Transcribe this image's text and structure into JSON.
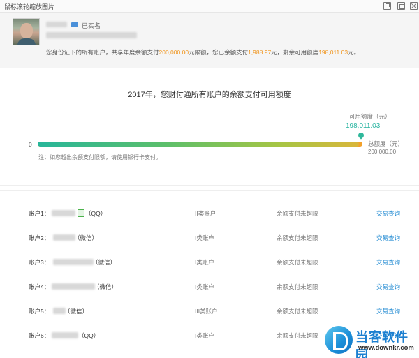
{
  "window": {
    "title": "鼠标滚轮缩放图片"
  },
  "profile": {
    "verified_label": "已实名",
    "limit_text_prefix": "您身份证下的所有账户，共享年度余额支付",
    "annual_limit": "200,000.00",
    "limit_text_mid1": "元限额，您已余额支付",
    "used_amount": "1,988.97",
    "limit_text_mid2": "元，剩余可用额度",
    "remaining_amount": "198,011.03",
    "limit_text_suffix": "元。"
  },
  "quota": {
    "title": "2017年，您财付通所有账户的余额支付可用额度",
    "available_label": "可用额度（元）",
    "available_value": "198,011.03",
    "zero_label": "0",
    "total_label": "总额度（元）",
    "total_value": "200,000.00",
    "available_fraction": 0.99,
    "note": "注：如您超出余额支付限额，请使用银行卡支付。"
  },
  "accounts": [
    {
      "label": "账户1：",
      "app": "（QQ）",
      "type": "II类账户",
      "status": "余额支付未超限",
      "action": "交易查询"
    },
    {
      "label": "账户2：",
      "app": "（微信）",
      "type": "I类账户",
      "status": "余额支付未超限",
      "action": "交易查询"
    },
    {
      "label": "账户3：",
      "app": "（微信）",
      "type": "I类账户",
      "status": "余额支付未超限",
      "action": "交易查询"
    },
    {
      "label": "账户4：",
      "app": "（微信）",
      "type": "I类账户",
      "status": "余额支付未超限",
      "action": "交易查询"
    },
    {
      "label": "账户5：",
      "app": "（微信）",
      "type": "III类账户",
      "status": "余额支付未超限",
      "action": "交易查询"
    },
    {
      "label": "账户6：",
      "app": "（QQ）",
      "type": "I类账户",
      "status": "余额支付未超限",
      "action": "交易查询"
    }
  ],
  "watermark": {
    "title": "当客软件园",
    "url": "www.downkr.com"
  },
  "colors": {
    "accent_green": "#2fb89b",
    "amount_orange": "#f0951d",
    "link_blue": "#2a8fd4"
  }
}
